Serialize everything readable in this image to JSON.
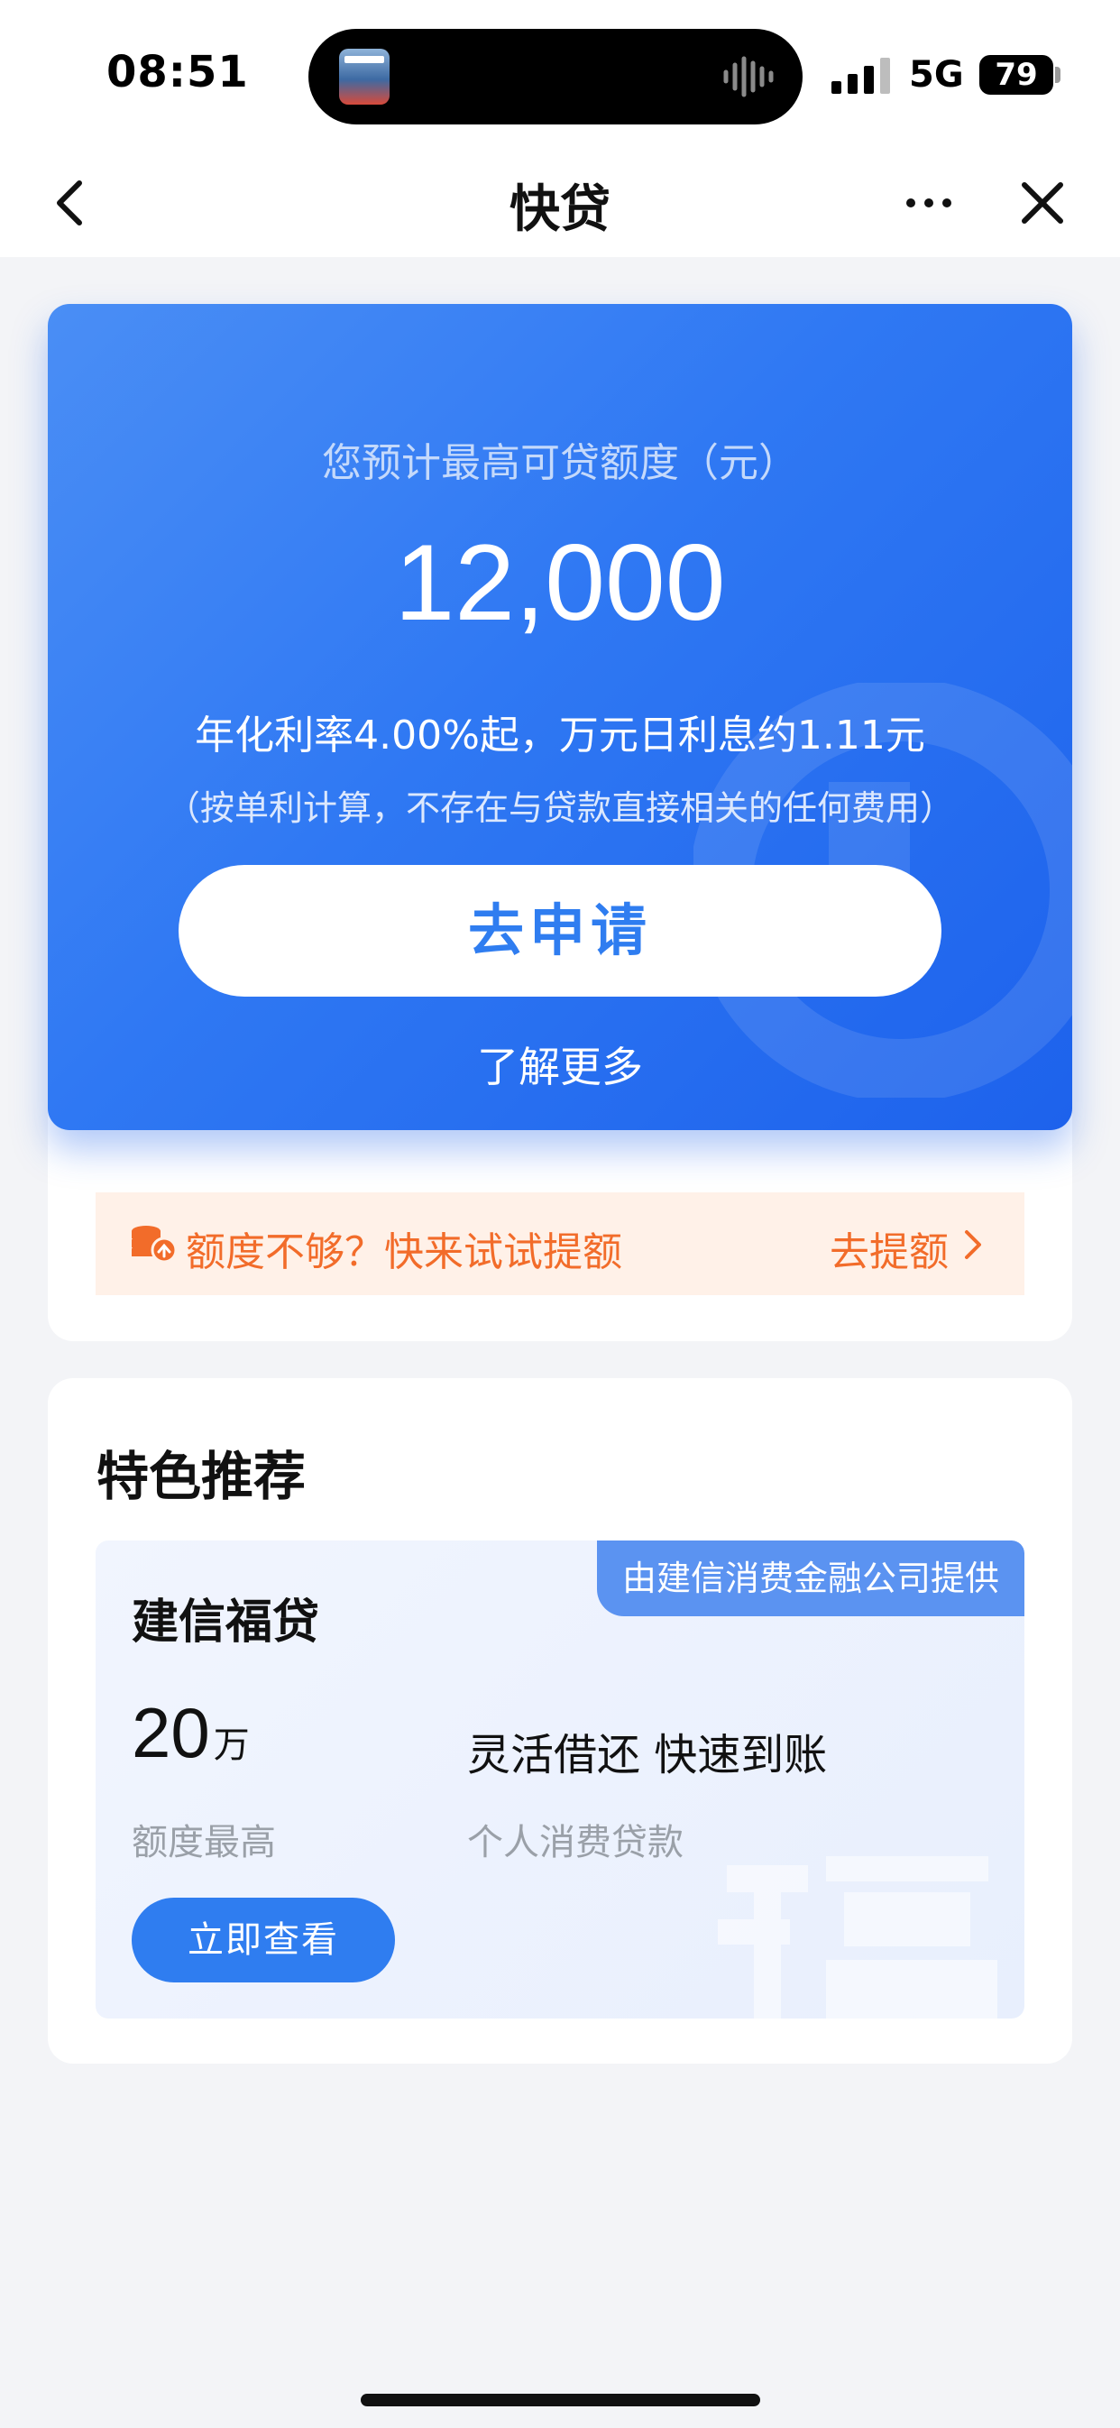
{
  "status_bar": {
    "time": "08:51",
    "network": "5G",
    "battery": "79"
  },
  "nav": {
    "title": "快贷",
    "back_icon": "chevron-left-icon",
    "more_icon": "more-dots-icon",
    "close_icon": "close-icon"
  },
  "hero": {
    "label": "您预计最高可贷额度（元）",
    "amount": "12,000",
    "rate_text": "年化利率4.00%起，万元日利息约1.11元",
    "note": "（按单利计算，不存在与贷款直接相关的任何费用）",
    "apply_label": "去申请",
    "learn_more_label": "了解更多"
  },
  "quota_banner": {
    "icon": "coins-up-icon",
    "text": "额度不够？快来试试提额",
    "action_label": "去提额"
  },
  "featured": {
    "title": "特色推荐",
    "product": {
      "provider_tag": "由建信消费金融公司提供",
      "name": "建信福贷",
      "amount_value": "20",
      "amount_unit": "万",
      "amount_label": "额度最高",
      "feature": "灵活借还 快速到账",
      "type": "个人消费贷款",
      "view_label": "立即查看"
    }
  },
  "colors": {
    "primary_blue": "#2f7df0",
    "hero_gradient_start": "#4a8ef5",
    "hero_gradient_end": "#1d62ec",
    "orange_accent": "#f26c2a",
    "banner_bg": "#fff1e8",
    "page_bg": "#f3f4f7"
  }
}
